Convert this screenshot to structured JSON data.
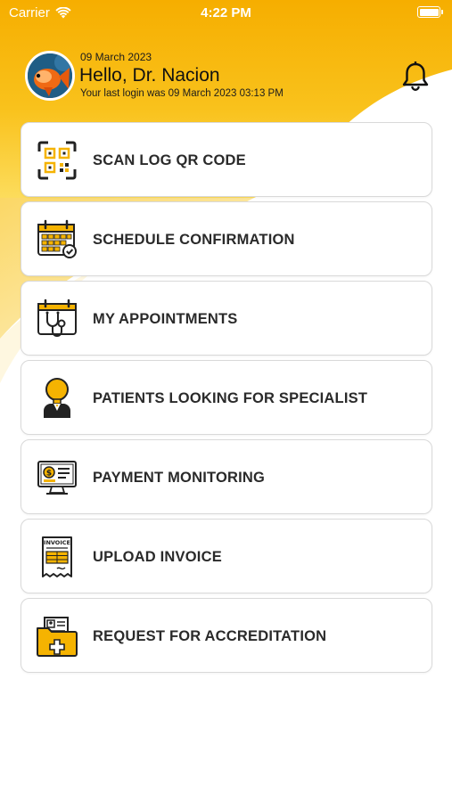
{
  "status_bar": {
    "carrier": "Carrier",
    "time": "4:22 PM"
  },
  "header": {
    "date": "09 March 2023",
    "greeting": "Hello, Dr. Nacion",
    "last_login": "Your last login was 09 March 2023 03:13 PM"
  },
  "menu": [
    {
      "label": "SCAN LOG QR CODE",
      "icon": "qr-code-icon"
    },
    {
      "label": "SCHEDULE CONFIRMATION",
      "icon": "calendar-check-icon"
    },
    {
      "label": "MY APPOINTMENTS",
      "icon": "calendar-stethoscope-icon"
    },
    {
      "label": "PATIENTS LOOKING FOR SPECIALIST",
      "icon": "doctor-icon"
    },
    {
      "label": "PAYMENT MONITORING",
      "icon": "monitor-payment-icon"
    },
    {
      "label": "UPLOAD INVOICE",
      "icon": "invoice-icon"
    },
    {
      "label": "REQUEST FOR ACCREDITATION",
      "icon": "medical-folder-icon"
    }
  ],
  "colors": {
    "accent": "#F5B301",
    "accent_light": "#FBD24A",
    "text": "#2A2A2A",
    "card_border": "#D9D9D9"
  }
}
